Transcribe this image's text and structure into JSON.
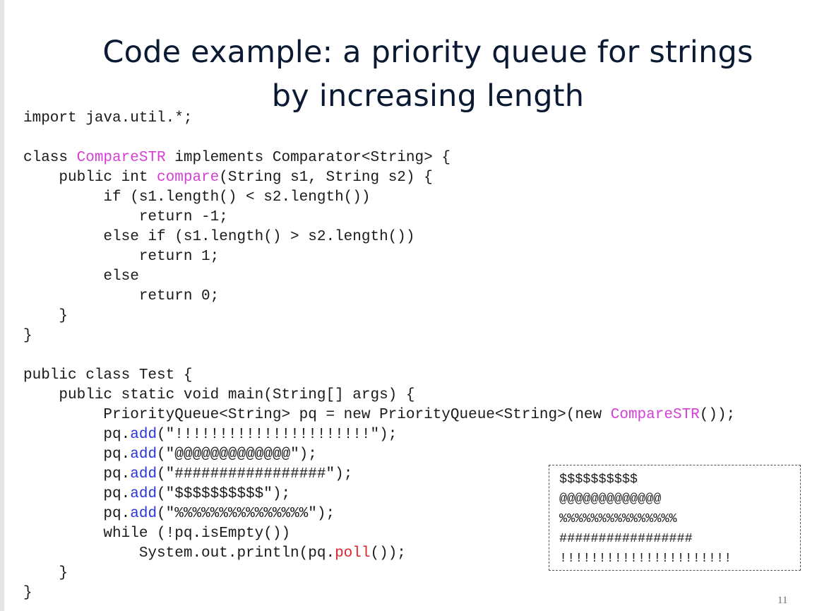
{
  "slide": {
    "title_line1": "Code example: a priority queue for strings",
    "title_line2": "by increasing length",
    "slide_number": "11"
  },
  "code": {
    "l01": "import java.util.*;",
    "l02": "",
    "l03_a": "class ",
    "l03_b": "CompareSTR",
    "l03_c": " implements Comparator<String> {",
    "l04_a": "    public int ",
    "l04_b": "compare",
    "l04_c": "(String s1, String s2) {",
    "l05": "         if (s1.length() < s2.length())",
    "l06": "             return -1;",
    "l07": "         else if (s1.length() > s2.length())",
    "l08": "             return 1;",
    "l09": "         else",
    "l10": "             return 0;",
    "l11": "    }",
    "l12": "}",
    "l13": "",
    "l14": "public class Test {",
    "l15": "    public static void main(String[] args) {",
    "l16_a": "         PriorityQueue<String> pq = new PriorityQueue<String>(new ",
    "l16_b": "CompareSTR",
    "l16_c": "());",
    "l17_a": "         pq.",
    "l17_b": "add",
    "l17_c": "(\"!!!!!!!!!!!!!!!!!!!!!!\");",
    "l18_a": "         pq.",
    "l18_b": "add",
    "l18_c": "(\"@@@@@@@@@@@@@\");",
    "l19_a": "         pq.",
    "l19_b": "add",
    "l19_c": "(\"#################\");",
    "l20_a": "         pq.",
    "l20_b": "add",
    "l20_c": "(\"$$$$$$$$$$\");",
    "l21_a": "         pq.",
    "l21_b": "add",
    "l21_c": "(\"%%%%%%%%%%%%%%%\");",
    "l22": "         while (!pq.isEmpty())",
    "l23_a": "             System.out.println(pq.",
    "l23_b": "poll",
    "l23_c": "());",
    "l24": "    }",
    "l25": "}"
  },
  "output": {
    "lines": [
      "$$$$$$$$$$",
      "@@@@@@@@@@@@@",
      "%%%%%%%%%%%%%%%",
      "#################",
      "!!!!!!!!!!!!!!!!!!!!!!"
    ]
  },
  "colors": {
    "identifier_magenta": "#d63fd6",
    "method_blue": "#2b36d9",
    "method_red": "#e0262b",
    "title": "#0b1a33"
  }
}
